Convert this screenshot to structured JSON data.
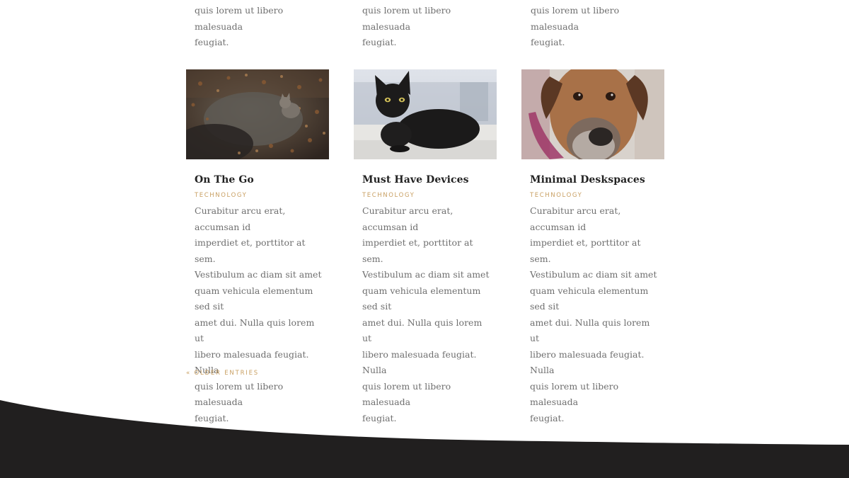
{
  "top_excerpts": [
    "quis lorem ut libero malesuada\nfeugiat.",
    "quis lorem ut libero malesuada\nfeugiat.",
    "quis lorem ut libero malesuada\nfeugiat."
  ],
  "posts": [
    {
      "title": "On The Go",
      "category": "TECHNOLOGY",
      "excerpt": "Curabitur arcu erat, accumsan id\nimperdiet et, porttitor at sem.\nVestibulum ac diam sit amet\nquam vehicula elementum sed sit\namet dui. Nulla quis lorem ut\nlibero malesuada feugiat. Nulla\nquis lorem ut libero malesuada\nfeugiat.",
      "image": "kitten-on-leaves-photo"
    },
    {
      "title": "Must Have Devices",
      "category": "TECHNOLOGY",
      "excerpt": "Curabitur arcu erat, accumsan id\nimperdiet et, porttitor at sem.\nVestibulum ac diam sit amet\nquam vehicula elementum sed sit\namet dui. Nulla quis lorem ut\nlibero malesuada feugiat. Nulla\nquis lorem ut libero malesuada\nfeugiat.",
      "image": "black-cat-photo"
    },
    {
      "title": "Minimal Deskspaces",
      "category": "TECHNOLOGY",
      "excerpt": "Curabitur arcu erat, accumsan id\nimperdiet et, porttitor at sem.\nVestibulum ac diam sit amet\nquam vehicula elementum sed sit\namet dui. Nulla quis lorem ut\nlibero malesuada feugiat. Nulla\nquis lorem ut libero malesuada\nfeugiat.",
      "image": "dog-face-photo"
    }
  ],
  "pagination": {
    "older_label": "« OLDER ENTRIES"
  },
  "colors": {
    "accent": "#c9a063",
    "text": "#6f6f6f",
    "title": "#222222",
    "footer": "#211f1f"
  }
}
